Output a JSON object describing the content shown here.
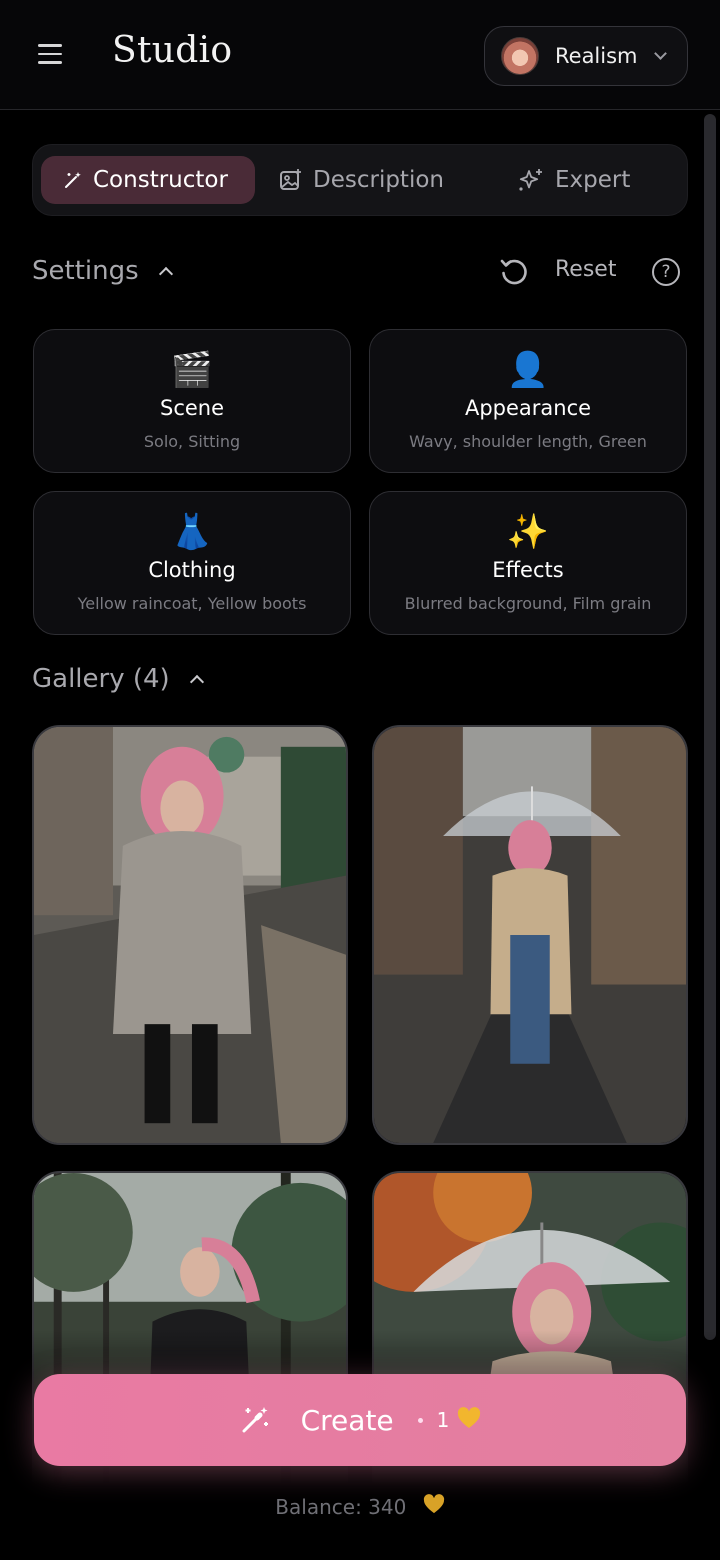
{
  "header": {
    "title": "Studio",
    "model": "Realism"
  },
  "tabs": [
    {
      "label": "Constructor",
      "active": true
    },
    {
      "label": "Description",
      "active": false
    },
    {
      "label": "Expert",
      "active": false
    }
  ],
  "settings": {
    "title": "Settings",
    "reset_label": "Reset",
    "help_symbol": "?"
  },
  "cards": [
    {
      "emoji": "🎬",
      "title": "Scene",
      "subtitle": "Solo, Sitting"
    },
    {
      "emoji": "👤",
      "title": "Appearance",
      "subtitle": "Wavy, shoulder length, Green"
    },
    {
      "emoji": "👗",
      "title": "Clothing",
      "subtitle": "Yellow raincoat, Yellow boots"
    },
    {
      "emoji": "✨",
      "title": "Effects",
      "subtitle": "Blurred background, Film grain"
    }
  ],
  "gallery": {
    "title": "Gallery (4)",
    "images": [
      "city-rain-woman-coffee",
      "street-rain-umbrella",
      "forest-rain-jacket",
      "autumn-umbrella"
    ]
  },
  "create": {
    "label": "Create",
    "cost": "1",
    "cost_icon": "yellow-heart"
  },
  "balance": {
    "label": "Balance: 340",
    "icon": "yellow-heart"
  },
  "colors": {
    "accent": "#e97aa3",
    "active_tab": "#4a2b37",
    "heart": "#f2b62e"
  }
}
